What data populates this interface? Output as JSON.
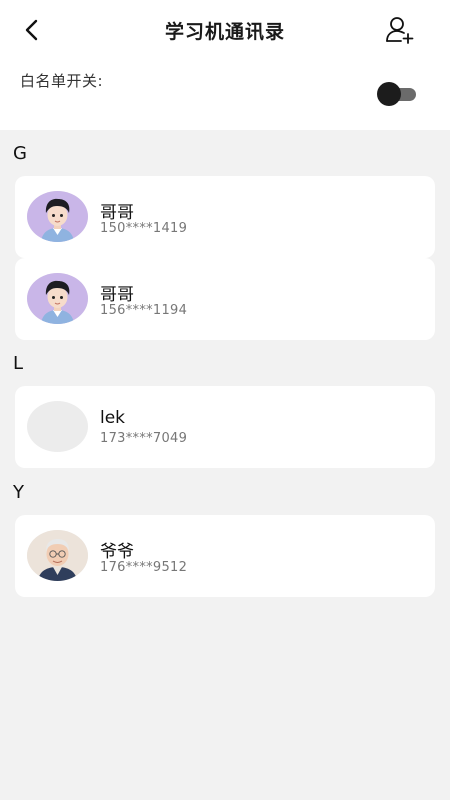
{
  "header": {
    "title": "学习机通讯录",
    "back_icon": "back-arrow-icon",
    "add_icon": "add-contact-icon"
  },
  "whitelist": {
    "label": "白名单开关:",
    "enabled": false
  },
  "sections": [
    {
      "letter": "G",
      "contacts": [
        {
          "name": "哥哥",
          "phone": "150****1419",
          "avatar": "boy-avatar"
        },
        {
          "name": "哥哥",
          "phone": "156****1194",
          "avatar": "boy-avatar"
        }
      ]
    },
    {
      "letter": "L",
      "contacts": [
        {
          "name": "lek",
          "phone": "173****7049",
          "avatar": "blank-avatar"
        }
      ]
    },
    {
      "letter": "Y",
      "contacts": [
        {
          "name": "爷爷",
          "phone": "176****9512",
          "avatar": "grandpa-avatar"
        }
      ]
    }
  ],
  "colors": {
    "background": "#f2f2f2",
    "card": "#ffffff",
    "avatar_purple": "#c9b6e8",
    "toggle_knob": "#1c1c1c",
    "toggle_track": "#6b6b6b"
  }
}
